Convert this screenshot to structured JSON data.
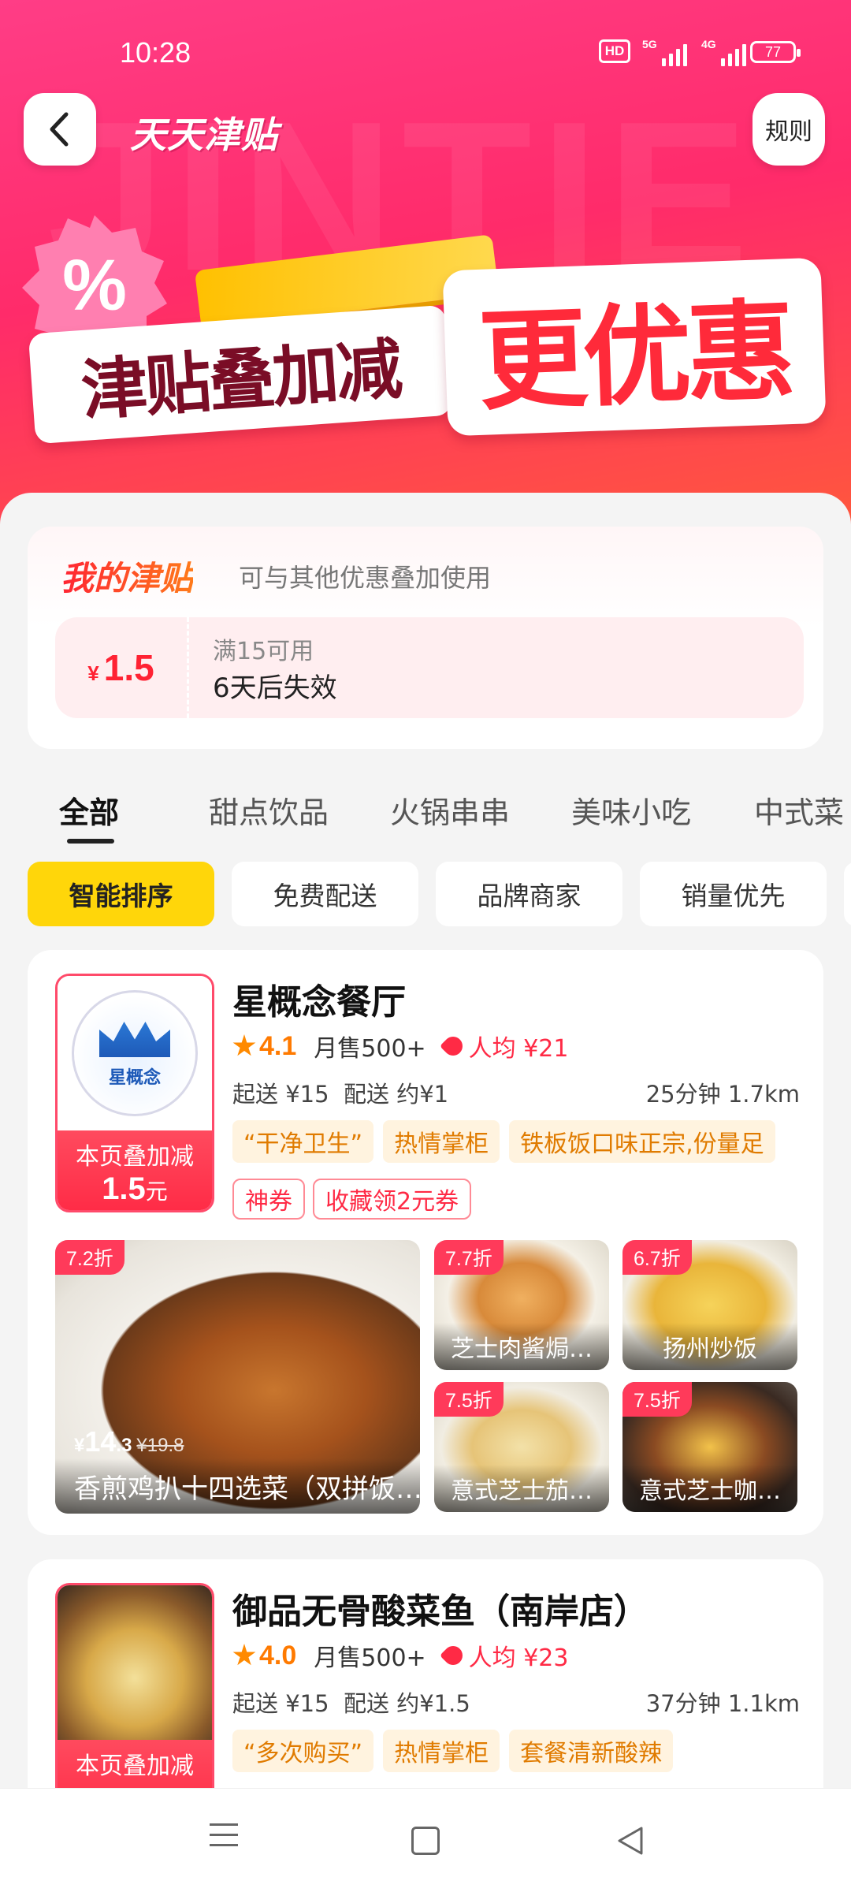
{
  "status_bar": {
    "time": "10:28",
    "hd": "HD",
    "net1": "5G",
    "net2": "4G",
    "battery": "77"
  },
  "header": {
    "title": "天天津贴",
    "rules_label": "规则",
    "watermark": "JINTIE"
  },
  "banner": {
    "line1": "津贴叠加减",
    "line2": "更优惠",
    "badge_symbol": "%"
  },
  "my_subsidy": {
    "title": "我的津贴",
    "subtitle": "可与其他优惠叠加使用",
    "coupon": {
      "currency": "¥",
      "amount": "1.5",
      "condition": "满15可用",
      "expiry": "6天后失效"
    }
  },
  "tabs": [
    {
      "label": "全部"
    },
    {
      "label": "甜点饮品"
    },
    {
      "label": "火锅串串"
    },
    {
      "label": "美味小吃"
    },
    {
      "label": "中式菜"
    }
  ],
  "sort_chips": [
    {
      "label": "智能排序"
    },
    {
      "label": "免费配送"
    },
    {
      "label": "品牌商家"
    },
    {
      "label": "销量优先"
    }
  ],
  "shops": [
    {
      "name": "星概念餐厅",
      "logo_text": "星概念",
      "promo_line1": "本页叠加减",
      "promo_amount": "1.5",
      "promo_unit": "元",
      "rating": "4.1",
      "monthly_sales": "月售500+",
      "avg_price": "人均 ¥21",
      "min_order": "起送 ¥15",
      "delivery_fee": "配送 约¥1",
      "time_distance": "25分钟  1.7km",
      "tags": [
        "“干净卫生”",
        "热情掌柜",
        "铁板饭口味正宗,份量足"
      ],
      "coupons": [
        "神券",
        "收藏领2元券"
      ],
      "dishes": [
        {
          "name": "香煎鸡扒十四选菜（双拼饭…",
          "discount": "7.2折",
          "currency": "¥",
          "price": "14",
          "price_decimal": ".3",
          "original": "¥19.8"
        },
        {
          "name": "芝士肉酱焗…",
          "discount": "7.7折"
        },
        {
          "name": "扬州炒饭",
          "discount": "6.7折"
        },
        {
          "name": "意式芝士茄…",
          "discount": "7.5折"
        },
        {
          "name": "意式芝士咖…",
          "discount": "7.5折"
        }
      ]
    },
    {
      "name": "御品无骨酸菜鱼（南岸店）",
      "promo_line1": "本页叠加减",
      "rating": "4.0",
      "monthly_sales": "月售500+",
      "avg_price": "人均 ¥23",
      "min_order": "起送 ¥15",
      "delivery_fee": "配送 约¥1.5",
      "time_distance": "37分钟  1.1km",
      "tags": [
        "“多次购买”",
        "热情掌柜",
        "套餐清新酸辣"
      ]
    }
  ]
}
